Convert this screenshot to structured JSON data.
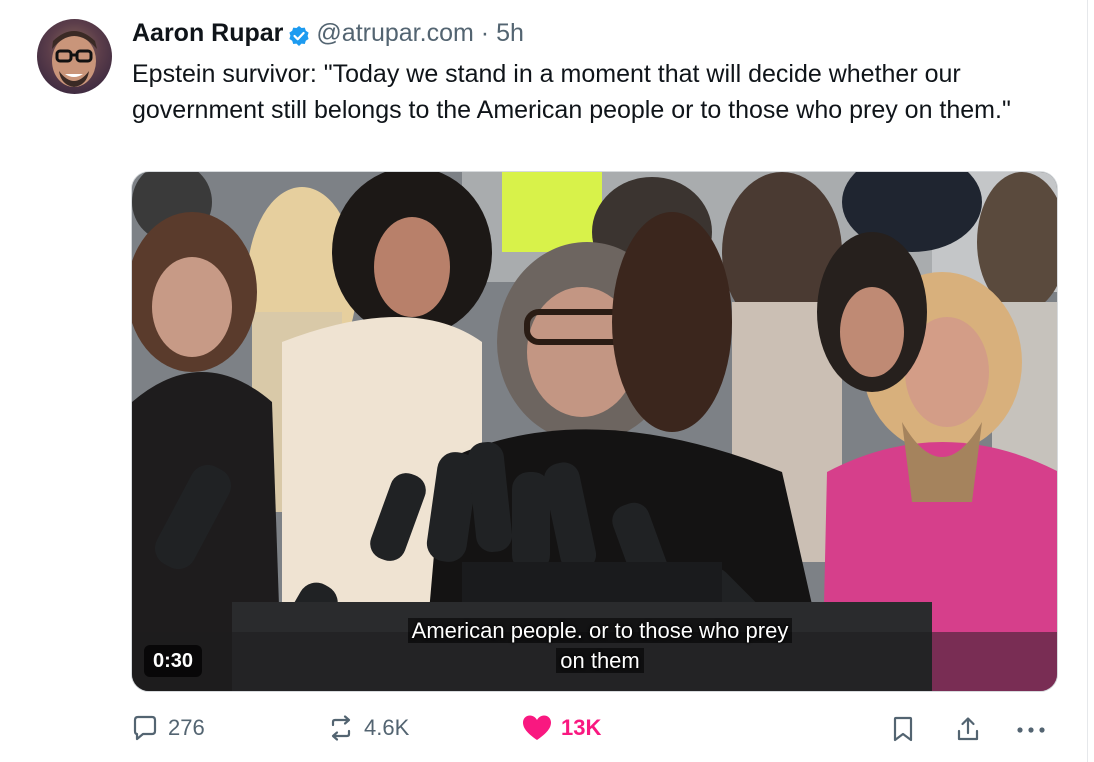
{
  "tweet": {
    "author_name": "Aaron Rupar",
    "handle": "@atrupar.com",
    "separator": "·",
    "time": "5h",
    "text": "Epstein survivor: \"Today we stand in a moment that will decide whether our government still belongs to the American people or to those who prey on them.\""
  },
  "media": {
    "duration": "0:30",
    "caption_line1": "American people. or to those who prey",
    "caption_line2": "on them"
  },
  "actions": {
    "replies": "276",
    "reposts": "4.6K",
    "likes": "13K"
  },
  "icons": {
    "verified": "verified-badge-icon",
    "reply": "reply-icon",
    "repost": "repost-icon",
    "like": "heart-icon",
    "bookmark": "bookmark-icon",
    "share": "share-icon",
    "more": "more-icon"
  },
  "colors": {
    "verified": "#1d9bf0",
    "like": "#f91880",
    "secondary_text": "#536471"
  }
}
